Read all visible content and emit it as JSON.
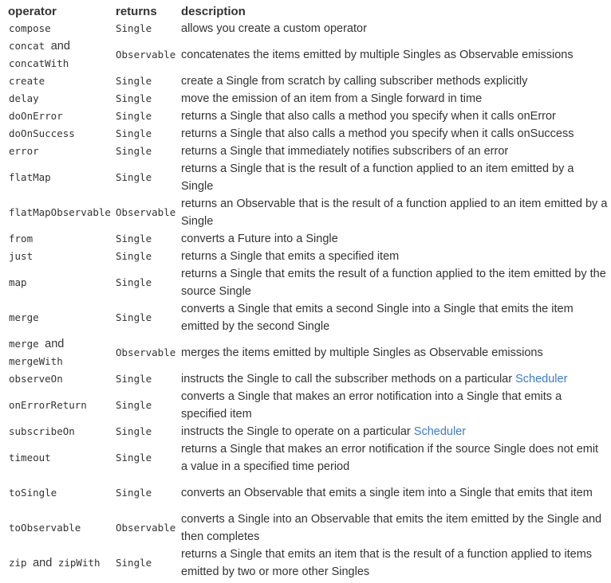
{
  "table": {
    "headers": [
      "operator",
      "returns",
      "description"
    ],
    "rows": [
      {
        "operator": "compose",
        "returns": "Single",
        "description": "allows you create a custom operator"
      },
      {
        "operator": "concat and concatWith",
        "op_code_1": "concat",
        "op_join": "and",
        "op_code_2": "concatWith",
        "returns": "Observable",
        "description": "concatenates the items emitted by multiple Singles as Observable emissions"
      },
      {
        "operator": "create",
        "returns": "Single",
        "description": "create a Single from scratch by calling subscriber methods explicitly"
      },
      {
        "operator": "delay",
        "returns": "Single",
        "description": "move the emission of an item from a Single forward in time"
      },
      {
        "operator": "doOnError",
        "returns": "Single",
        "description": "returns a Single that also calls a method you specify when it calls onError"
      },
      {
        "operator": "doOnSuccess",
        "returns": "Single",
        "description": "returns a Single that also calls a method you specify when it calls onSuccess"
      },
      {
        "operator": "error",
        "returns": "Single",
        "description": "returns a Single that immediately notifies subscribers of an error"
      },
      {
        "operator": "flatMap",
        "returns": "Single",
        "description": "returns a Single that is the result of a function applied to an item emitted by a Single"
      },
      {
        "operator": "flatMapObservable",
        "returns": "Observable",
        "description": "returns an Observable that is the result of a function applied to an item emitted by a Single"
      },
      {
        "operator": "from",
        "returns": "Single",
        "description": "converts a Future into a Single"
      },
      {
        "operator": "just",
        "returns": "Single",
        "description": "returns a Single that emits a specified item"
      },
      {
        "operator": "map",
        "returns": "Single",
        "description": "returns a Single that emits the result of a function applied to the item emitted by the source Single"
      },
      {
        "operator": "merge",
        "returns": "Single",
        "description": "converts a Single that emits a second Single into a Single that emits the item emitted by the second Single"
      },
      {
        "operator": "merge and mergeWith",
        "op_code_1": "merge",
        "op_join": "and",
        "op_code_2": "mergeWith",
        "returns": "Observable",
        "description": "merges the items emitted by multiple Singles as Observable emissions"
      },
      {
        "operator": "observeOn",
        "returns": "Single",
        "description_pre": "instructs the Single to call the subscriber methods on a particular ",
        "description_link": "Scheduler"
      },
      {
        "operator": "onErrorReturn",
        "returns": "Single",
        "description": "converts a Single that makes an error notification into a Single that emits a specified item"
      },
      {
        "operator": "subscribeOn",
        "returns": "Single",
        "description_pre": "instructs the Single to operate on a particular ",
        "description_link": "Scheduler"
      },
      {
        "operator": "timeout",
        "returns": "Single",
        "description": "returns a Single that makes an error notification if the source Single does not emit a value in a specified time period"
      },
      {
        "operator": "toSingle",
        "returns": "Single",
        "description": "converts an Observable that emits a single item into a Single that emits that item"
      },
      {
        "operator": "toObservable",
        "returns": "Observable",
        "description": "converts a Single into an Observable that emits the item emitted by the Single and then completes"
      },
      {
        "operator": "zip and zipWith",
        "op_code_1": "zip",
        "op_join": "and",
        "op_code_2": "zipWith",
        "returns": "Single",
        "description": "returns a Single that emits an item that is the result of a function applied to items emitted by two or more other Singles"
      }
    ]
  },
  "colors": {
    "text": "#333333",
    "link": "#3a7bd5",
    "background": "#ffffff"
  }
}
